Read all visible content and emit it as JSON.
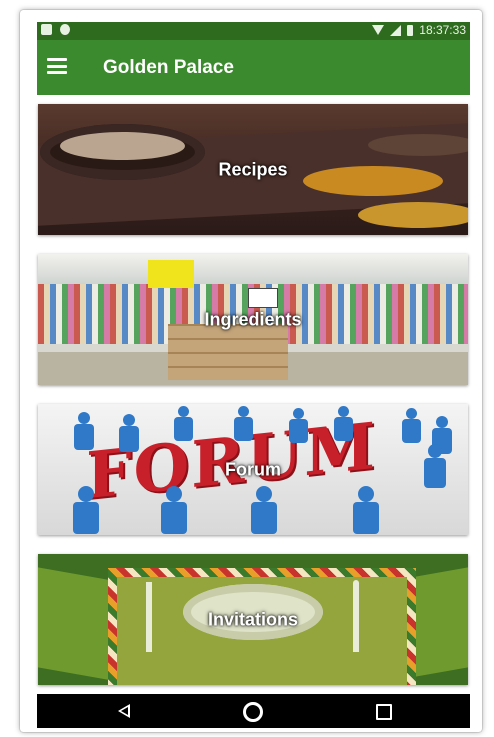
{
  "status_bar": {
    "time": "18:37:33",
    "icons": [
      "image-icon",
      "notification-icon",
      "wifi-icon",
      "signal-icon",
      "battery-icon"
    ]
  },
  "app_bar": {
    "title": "Golden Palace",
    "menu_icon": "hamburger-menu-icon",
    "color": "#3b8a2e"
  },
  "cards": [
    {
      "label": "Recipes",
      "image": "spices-bowl-photo"
    },
    {
      "label": "Ingredients",
      "image": "supermarket-photo"
    },
    {
      "label": "Forum",
      "image": "forum-people-illustration"
    },
    {
      "label": "Invitations",
      "image": "invitation-card-photo"
    }
  ],
  "nav_bar": {
    "buttons": [
      "back-icon",
      "home-icon",
      "recent-apps-icon"
    ]
  },
  "colors": {
    "status_bar": "#2e6b1e",
    "app_bar": "#3b8a2e",
    "nav_bar": "#000000"
  }
}
